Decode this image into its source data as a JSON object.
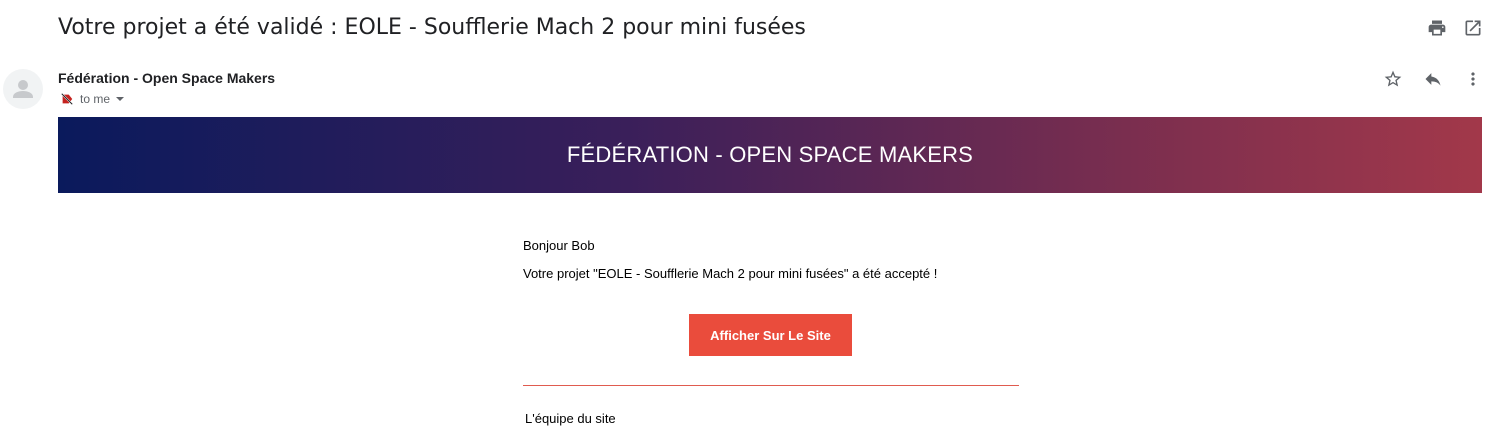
{
  "email": {
    "subject": "Votre projet a été validé : EOLE - Soufflerie Mach 2 pour mini fusées",
    "sender": "Fédération - Open Space Makers",
    "recipient": "to me"
  },
  "icons": {
    "print": "print-icon",
    "open_new_window": "open-in-new-icon",
    "avatar": "person-icon",
    "label": "label-off-icon",
    "chevron": "chevron-down-icon",
    "star": "star-icon",
    "reply": "reply-icon",
    "more": "more-vert-icon"
  },
  "message": {
    "banner_title": "FÉDÉRATION - OPEN SPACE MAKERS",
    "greeting": "Bonjour Bob",
    "body": "Votre projet \"EOLE - Soufflerie Mach 2 pour mini fusées\" a été accepté !",
    "button_label": "Afficher Sur Le Site",
    "signature": "L'équipe du site"
  },
  "colors": {
    "banner_gradient_start": "#0a1a5c",
    "banner_gradient_end": "#a2384a",
    "button": "#ea4c3c",
    "divider": "#e05b4f"
  }
}
